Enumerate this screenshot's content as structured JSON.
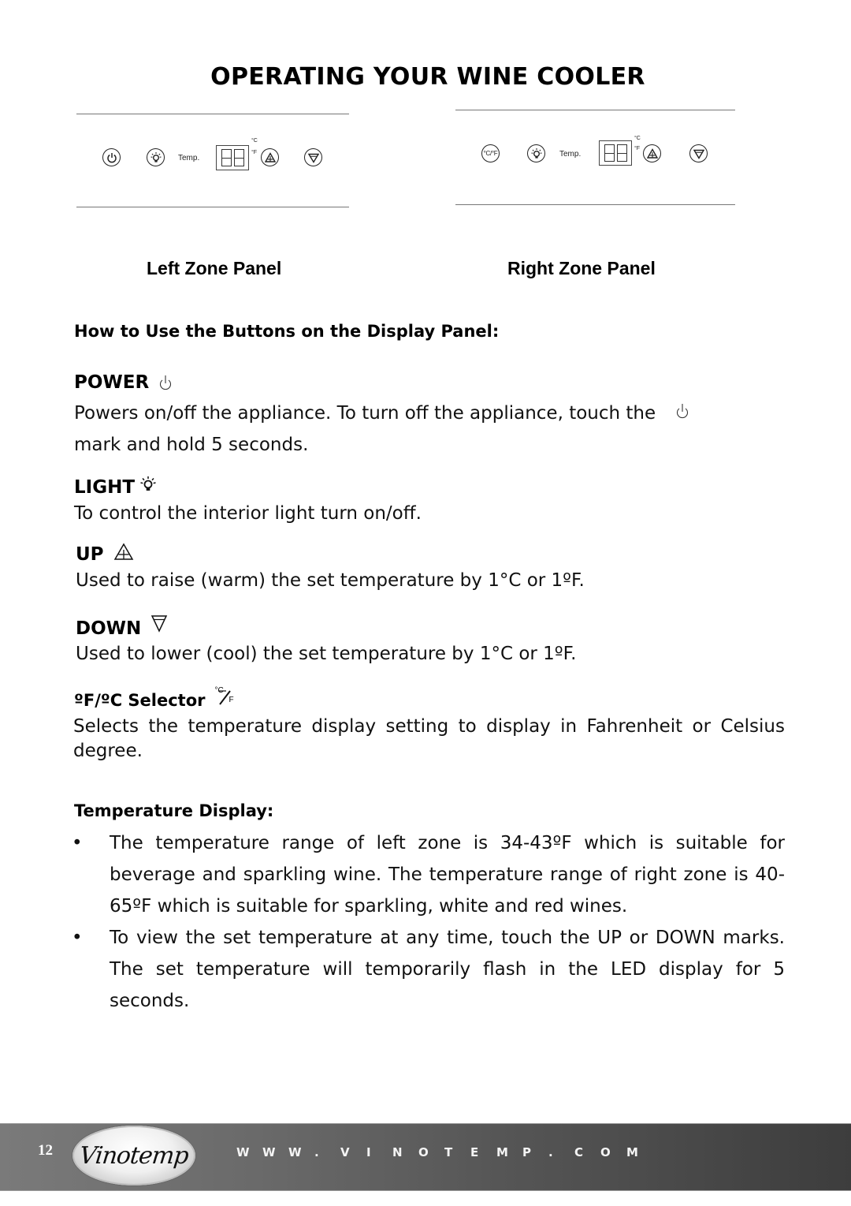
{
  "page": {
    "title": "OPERATING YOUR WINE COOLER",
    "page_number": "12"
  },
  "panels": {
    "left": {
      "label": "Left Zone Panel",
      "first_button": "power",
      "temp_label": "Temp.",
      "unit_c": "°C",
      "unit_f": "°F"
    },
    "right": {
      "label": "Right Zone Panel",
      "first_button": "celsius-fahrenheit",
      "first_button_text": "°C/°F",
      "temp_label": "Temp.",
      "unit_c": "°C",
      "unit_f": "°F"
    }
  },
  "instructions": {
    "heading": "How to Use the Buttons on the Display Panel:",
    "power": {
      "title": "POWER",
      "icon": "power-icon",
      "text_part1": "Powers on/off the appliance. To turn off the appliance, touch the",
      "text_part2": "mark and hold 5 seconds."
    },
    "light": {
      "title": "LIGHT",
      "icon": "lightbulb-icon",
      "text": "To control the interior light turn on/off."
    },
    "up": {
      "title": "UP",
      "icon": "up-triangle-icon",
      "text": "Used to raise (warm) the set temperature by 1°C or 1ºF."
    },
    "down": {
      "title": "DOWN",
      "icon": "down-triangle-icon",
      "text": "Used to lower (cool) the set temperature by 1°C or 1ºF."
    },
    "selector": {
      "title": "ºF/ºC Selector",
      "icon": "celsius-fahrenheit-icon",
      "icon_c": "°C",
      "icon_f": "F",
      "text": "Selects the temperature display setting to display in Fahrenheit or Celsius degree."
    }
  },
  "temperature_display": {
    "heading": "Temperature Display:",
    "bullet_char": "•",
    "bullets": [
      "The temperature range of left zone is 34-43ºF which is suitable for beverage and sparkling wine. The temperature range of right zone is 40-65ºF which is suitable for sparkling, white and red wines.",
      "To view the set temperature at any time, touch the UP or DOWN marks. The set temperature will temporarily flash in the LED display for 5 seconds."
    ]
  },
  "footer": {
    "brand": "Vinotemp",
    "url_letters": [
      "W",
      "W",
      "W",
      ".",
      "V",
      "I",
      "N",
      "O",
      "T",
      "E",
      "M",
      "P",
      ".",
      "C",
      "O",
      "M"
    ]
  }
}
